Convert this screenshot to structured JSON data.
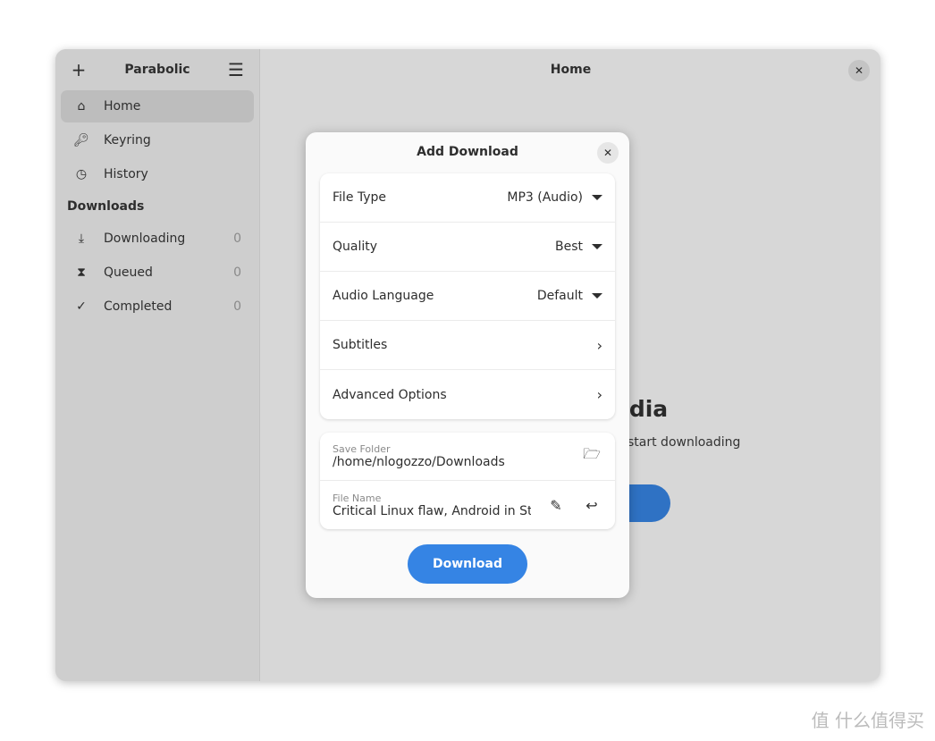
{
  "sidebar": {
    "title": "Parabolic",
    "items": [
      {
        "label": "Home",
        "icon": "home-icon"
      },
      {
        "label": "Keyring",
        "icon": "key-icon"
      },
      {
        "label": "History",
        "icon": "clock-icon"
      }
    ],
    "section": "Downloads",
    "downloads": [
      {
        "label": "Downloading",
        "count": "0"
      },
      {
        "label": "Queued",
        "count": "0"
      },
      {
        "label": "Completed",
        "count": "0"
      }
    ]
  },
  "main": {
    "title": "Home",
    "bg_title": "Media",
    "bg_subtitle": "start downloading"
  },
  "dialog": {
    "title": "Add Download",
    "options": [
      {
        "label": "File Type",
        "value": "MP3 (Audio)"
      },
      {
        "label": "Quality",
        "value": "Best"
      },
      {
        "label": "Audio Language",
        "value": "Default"
      }
    ],
    "links": [
      {
        "label": "Subtitles"
      },
      {
        "label": "Advanced Options"
      }
    ],
    "save_folder": {
      "caption": "Save Folder",
      "value": "/home/nlogozzo/Downloads"
    },
    "file_name": {
      "caption": "File Name",
      "value": "Critical Linux flaw, Android in Steam"
    },
    "download_label": "Download"
  },
  "watermark": "值 什么值得买",
  "colors": {
    "accent": "#3584e4"
  }
}
